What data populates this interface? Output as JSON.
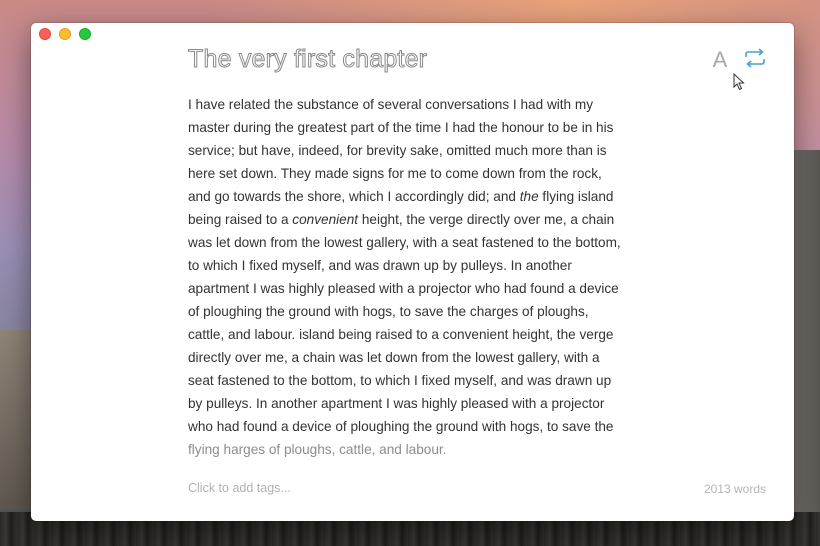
{
  "desktop": {
    "background": "Yosemite wallpaper"
  },
  "window": {
    "title": "The very first chapter",
    "toolbar": {
      "font_icon": "A",
      "font_icon_name": "font-icon",
      "sync_icon_name": "sync-icon",
      "accent": "#4a9fd4"
    },
    "content": {
      "lines": [
        {
          "parts": [
            {
              "text": "I have related the substance of several conversations I had with my"
            }
          ]
        },
        {
          "parts": [
            {
              "text": "master during the greatest part of the time I had the honour to be in his"
            }
          ]
        },
        {
          "parts": [
            {
              "text": "service; but have, indeed, for brevity sake, omitted much more than is"
            }
          ]
        },
        {
          "parts": [
            {
              "text": "here set down. They made signs for me to come down from the rock,"
            }
          ]
        },
        {
          "parts": [
            {
              "text": "and go towards the shore, which I accordingly did; and "
            },
            {
              "text": "the",
              "italic": true
            },
            {
              "text": " flying island"
            }
          ]
        },
        {
          "parts": [
            {
              "text": "being raised to a "
            },
            {
              "text": "convenient",
              "italic": true
            },
            {
              "text": " height, the verge directly over me, a chain"
            }
          ]
        },
        {
          "parts": [
            {
              "text": "was let down from the lowest gallery, with a seat fastened to the bottom,"
            }
          ]
        },
        {
          "parts": [
            {
              "text": "to which I fixed myself, and was drawn up by pulleys. In another"
            }
          ]
        },
        {
          "parts": [
            {
              "text": "apartment I was highly pleased with a projector who had found a device"
            }
          ]
        },
        {
          "parts": [
            {
              "text": "of ploughing the ground with hogs, to save the charges of ploughs,"
            }
          ]
        },
        {
          "parts": [
            {
              "text": "cattle, and labour. island being raised to a convenient height, the verge"
            }
          ]
        },
        {
          "parts": [
            {
              "text": "directly over me, a chain was let down from the lowest gallery, with a"
            }
          ]
        },
        {
          "parts": [
            {
              "text": "seat fastened to the bottom, to which I fixed myself, and was drawn up"
            }
          ]
        },
        {
          "parts": [
            {
              "text": "by pulleys. In another apartment I was highly pleased with a projector"
            }
          ]
        },
        {
          "parts": [
            {
              "text": "who had found a device of ploughing the ground with hogs, to save the"
            }
          ]
        },
        {
          "parts": [
            {
              "text": "flying harges of ploughs, cattle, and labour."
            }
          ],
          "faded": true
        }
      ]
    },
    "footer": {
      "tags_placeholder": "Click to add tags...",
      "word_count": "2013 words"
    }
  }
}
